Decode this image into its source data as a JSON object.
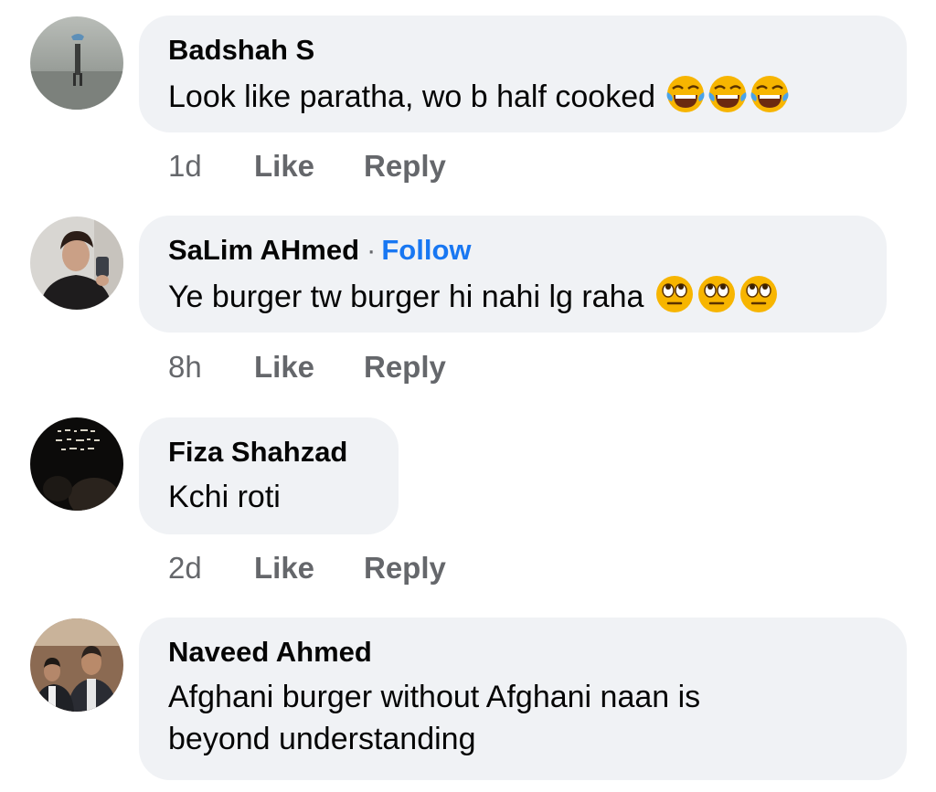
{
  "comments": [
    {
      "author": "Badshah S",
      "text": "Look like paratha, wo b half cooked",
      "emoji": "face-with-tears-of-joy-icon",
      "emoji_count": 3,
      "time": "1d",
      "like_label": "Like",
      "reply_label": "Reply"
    },
    {
      "author": "SaLim AHmed",
      "separator": "·",
      "follow_label": "Follow",
      "text": "Ye burger tw burger hi nahi lg raha",
      "emoji": "face-with-rolling-eyes-icon",
      "emoji_count": 3,
      "time": "8h",
      "like_label": "Like",
      "reply_label": "Reply"
    },
    {
      "author": "Fiza Shahzad",
      "text": "Kchi roti",
      "time": "2d",
      "like_label": "Like",
      "reply_label": "Reply"
    },
    {
      "author": "Naveed Ahmed",
      "text_line1": "Afghani burger without Afghani naan is",
      "text_line2": "beyond understanding"
    }
  ],
  "colors": {
    "bubble_bg": "#f0f2f5",
    "meta_text": "#65676b",
    "follow": "#1877f2",
    "text": "#050505"
  }
}
